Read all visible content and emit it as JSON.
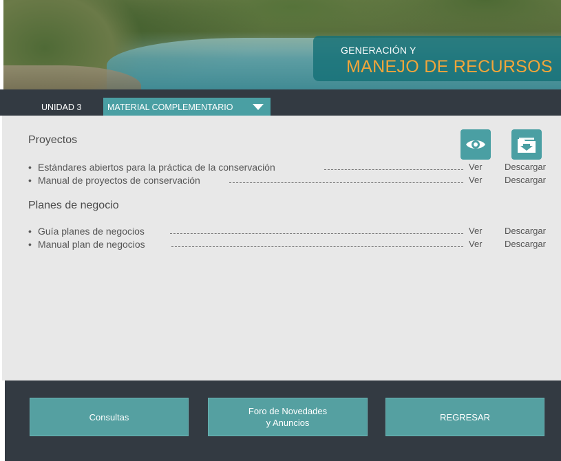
{
  "banner": {
    "title_line1": "GENERACIÓN Y",
    "title_line2": "MANEJO DE RECURSOS"
  },
  "nav": {
    "unit": "UNIDAD 3",
    "active_tab": "MATERIAL COMPLEMENTARIO",
    "dropdown_icon": "caret-down-icon"
  },
  "header_icons": {
    "view_icon": "eye-icon",
    "download_icon": "download-folder-icon"
  },
  "sections": [
    {
      "title": "Proyectos",
      "items": [
        {
          "label": "Estándares abiertos para la práctica de la conservación",
          "view": "Ver",
          "download": "Descargar"
        },
        {
          "label": "Manual de proyectos de conservación",
          "view": "Ver",
          "download": "Descargar"
        }
      ]
    },
    {
      "title": "Planes de negocio",
      "items": [
        {
          "label": "Guía planes de negocios",
          "view": "Ver",
          "download": "Descargar"
        },
        {
          "label": "Manual plan de negocios",
          "view": "Ver",
          "download": "Descargar"
        }
      ]
    }
  ],
  "bullet": "•",
  "footer": {
    "consultas": "Consultas",
    "foro": "Foro de Novedades\ny Anuncios",
    "regresar": "REGRESAR"
  },
  "colors": {
    "accent": "#4a9fa3",
    "dark_bar": "#333a42",
    "title_orange": "#f2a53a",
    "content_bg": "#e8e8e8"
  }
}
